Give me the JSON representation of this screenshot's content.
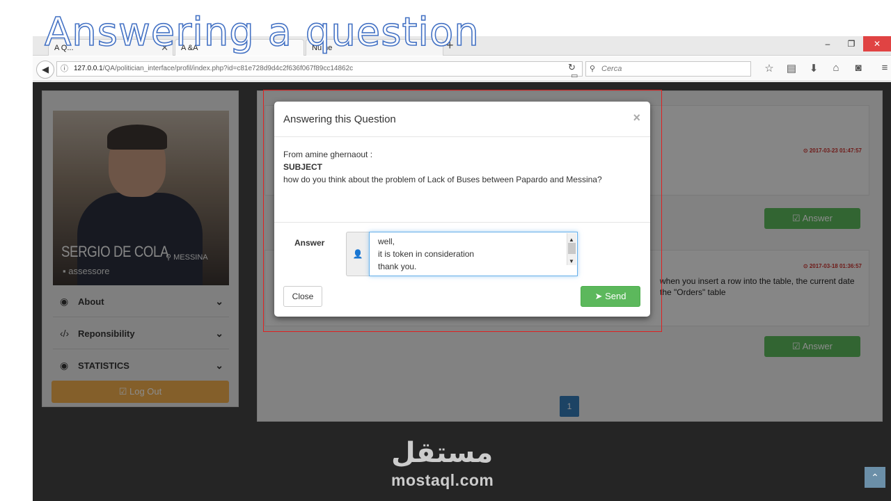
{
  "slide": {
    "title": "Answering a question"
  },
  "browser": {
    "tabs": [
      {
        "label": "A Q..."
      },
      {
        "label": "A  &A"
      },
      {
        "label": "Nu  he"
      }
    ],
    "new_tab": "+",
    "window_buttons": {
      "minimize": "–",
      "restore": "❐",
      "close": "✕"
    },
    "url": {
      "host": "127.0.0.1",
      "path": "/QA/politician_interface/profil/index.php?id=c81e728d9d4c2f636f067f89cc14862c"
    },
    "search_placeholder": "Cerca",
    "icons": [
      "star-icon",
      "library-icon",
      "download-icon",
      "home-icon",
      "pocket-icon",
      "hamburger-menu-icon"
    ]
  },
  "profile": {
    "name": "SERGIO DE COLA",
    "city": "MESSINA",
    "role": "assessore"
  },
  "sidebar": {
    "items": [
      {
        "label": "About",
        "icon": "globe-icon"
      },
      {
        "label": "Reponsibility",
        "icon": "code-icon"
      },
      {
        "label": "STATISTICS",
        "icon": "globe-icon"
      }
    ],
    "logout_label": "Log Out"
  },
  "questions": [
    {
      "date": "2017-03-23 01:47:57",
      "text_line1": "",
      "text_line2": "",
      "answer_label": "Answer"
    },
    {
      "date": "2017-03-18 01:36:57",
      "text_line1": "when you insert a row into the table, the current date",
      "text_line2": "the \"Orders\" table",
      "answer_label": "Answer"
    }
  ],
  "pagination": {
    "current": "1"
  },
  "footer": {
    "logo_arabic": "مستقل",
    "logo_text": "mostaql.com"
  },
  "modal": {
    "title": "Answering this Question",
    "close_x": "×",
    "from": "From amine ghernaout :",
    "subject_label": "SUBJECT",
    "question": "how do you think about the problem of Lack of Buses between Papardo and Messina?",
    "answer_label": "Answer",
    "answer_lines": [
      "well,",
      "it is token in consideration",
      "thank you."
    ],
    "close_label": "Close",
    "send_label": "Send"
  }
}
